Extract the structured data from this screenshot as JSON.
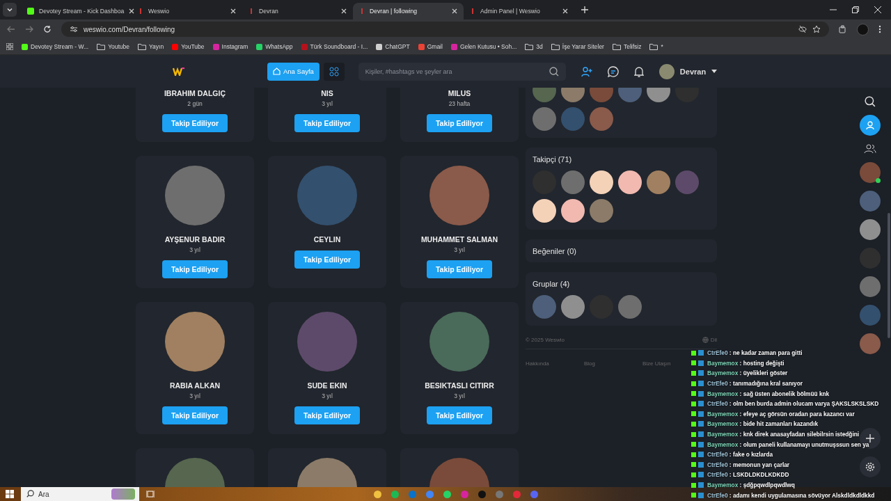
{
  "browser": {
    "tabs": [
      {
        "title": "Devotey Stream - Kick Dashboa",
        "selected": false,
        "kind": "kick"
      },
      {
        "title": "Weswio",
        "selected": false,
        "kind": "site"
      },
      {
        "title": "Devran",
        "selected": false,
        "kind": "site"
      },
      {
        "title": "Devran | following",
        "selected": true,
        "kind": "site"
      },
      {
        "title": "Admin Panel | Weswio",
        "selected": false,
        "kind": "site"
      }
    ],
    "url": "weswio.com/Devran/following",
    "bookmarks": [
      {
        "label": "Devotey Stream - W...",
        "kind": "kick"
      },
      {
        "label": "Youtube",
        "kind": "folder"
      },
      {
        "label": "Yayın",
        "kind": "folder"
      },
      {
        "label": "YouTube",
        "kind": "youtube"
      },
      {
        "label": "Instagram",
        "kind": "instagram"
      },
      {
        "label": "WhatsApp",
        "kind": "whatsapp"
      },
      {
        "label": "Türk Soundboard - I...",
        "kind": "site"
      },
      {
        "label": "ChatGPT",
        "kind": "chatgpt"
      },
      {
        "label": "Gmail",
        "kind": "gmail"
      },
      {
        "label": "Gelen Kutusu • Soh...",
        "kind": "instagram"
      },
      {
        "label": "3d",
        "kind": "folder"
      },
      {
        "label": "İşe Yarar Siteler",
        "kind": "folder"
      },
      {
        "label": "Telifsiz",
        "kind": "folder"
      },
      {
        "label": "*",
        "kind": "folder"
      }
    ]
  },
  "header": {
    "home_button": "Ana Sayfa",
    "search_placeholder": "Kişiler, #hashtags ve şeyler ara",
    "user": "Devran"
  },
  "following": [
    {
      "kind": "full",
      "name": "IBRAHIM DALGIÇ",
      "time": "2 gün",
      "button": "Takip Ediliyor"
    },
    {
      "kind": "full",
      "name": "NIS",
      "time": "3 yıl",
      "button": "Takip Ediliyor"
    },
    {
      "kind": "full",
      "name": "MILUS",
      "time": "23 hafta",
      "button": "Takip Ediliyor"
    },
    {
      "kind": "full",
      "name": "AYŞENUR BADIR",
      "time": "3 yıl",
      "button": "Takip Ediliyor"
    },
    {
      "kind": "full",
      "name": "CEYLIN",
      "button": "Takip Ediliyor"
    },
    {
      "kind": "full",
      "name": "MUHAMMET SALMAN",
      "time": "3 yıl",
      "button": "Takip Ediliyor"
    },
    {
      "kind": "full",
      "name": "RABIA ALKAN",
      "time": "3 yıl",
      "button": "Takip Ediliyor"
    },
    {
      "kind": "full",
      "name": "SUDE EKIN",
      "time": "3 yıl",
      "button": "Takip Ediliyor"
    },
    {
      "kind": "full",
      "name": "BESIKTASLI CITIRR",
      "time": "3 yıl",
      "button": "Takip Ediliyor"
    },
    {
      "kind": "photo"
    },
    {
      "kind": "photo"
    },
    {
      "kind": "photo"
    }
  ],
  "panels": [
    {
      "kind": "avatars",
      "avatars": [
        {
          "kind": "photo"
        },
        {
          "kind": "photo"
        },
        {
          "kind": "photo"
        },
        {
          "kind": "photo"
        },
        {
          "kind": "photo"
        },
        {
          "kind": "photo"
        },
        {
          "kind": "photo"
        },
        {
          "kind": "photo"
        },
        {
          "kind": "photo"
        }
      ]
    },
    {
      "kind": "avatars",
      "title": "Takipçi (71)",
      "avatars": [
        {
          "kind": "photo"
        },
        {
          "kind": "photo"
        },
        {
          "kind": "illustration"
        },
        {
          "kind": "illustration"
        },
        {
          "kind": "photo"
        },
        {
          "kind": "photo"
        },
        {
          "kind": "illustration"
        },
        {
          "kind": "illustration"
        },
        {
          "kind": "photo"
        }
      ]
    },
    {
      "kind": "title",
      "title": "Beğeniler (0)"
    },
    {
      "kind": "avatars",
      "title": "Gruplar (4)",
      "avatars": [
        {
          "kind": "photo"
        },
        {
          "kind": "photo"
        },
        {
          "kind": "photo"
        },
        {
          "kind": "photo"
        }
      ]
    }
  ],
  "footer": {
    "copyright": "© 2025 Weswio",
    "language": "Dil",
    "links": [
      "Hakkında",
      "Blog",
      "Bize Ulaşın"
    ]
  },
  "chat": [
    {
      "user": "CtrEfe0",
      "color": "#9fc3d6",
      "text": ": ne kadar zaman para gitti"
    },
    {
      "user": "Baymemox",
      "color": "#7fd6b8",
      "text": ": hosting değişti"
    },
    {
      "user": "Baymemox",
      "color": "#7fd6b8",
      "text": ": üyelikleri göster"
    },
    {
      "user": "CtrEfe0",
      "color": "#9fc3d6",
      "text": ": tanımadığına kral sanıyor"
    },
    {
      "user": "Baymemox",
      "color": "#7fd6b8",
      "text": ": sağ üsten abonelik bölmüü knk"
    },
    {
      "user": "CtrEfe0",
      "color": "#9fc3d6",
      "text": ": olm ben burda admin olucam varya ŞAKSLSKSLSKD"
    },
    {
      "user": "Baymemox",
      "color": "#7fd6b8",
      "text": ": efeye aç görsün oradan para kazancı var"
    },
    {
      "user": "Baymemox",
      "color": "#7fd6b8",
      "text": ": bide hit zamanları kazandık"
    },
    {
      "user": "Baymemox",
      "color": "#7fd6b8",
      "text": ": knk direk anasayfadan silebilrsin istedğini"
    },
    {
      "user": "Baymemox",
      "color": "#7fd6b8",
      "text": ": olum paneli kullanamayı unutmuşssun sen ya"
    },
    {
      "user": "CtrEfe0",
      "color": "#9fc3d6",
      "text": ": fake o kızlarda"
    },
    {
      "user": "CtrEfe0",
      "color": "#9fc3d6",
      "text": ": memonun yan çarlar"
    },
    {
      "user": "CtrEfe0",
      "color": "#9fc3d6",
      "text": ": LSKDLDKDLKDKDD"
    },
    {
      "user": "Baymemox",
      "color": "#7fd6b8",
      "text": ": şdğpqwdlpqwdlwq"
    },
    {
      "user": "CtrEfe0",
      "color": "#9fc3d6",
      "text": ": adamı kendi uygulamasına sövüyor Alskdldkdldkkd"
    }
  ],
  "rail": {
    "avatars": [
      {
        "kind": "photo",
        "online": true
      },
      {
        "kind": "photo"
      },
      {
        "kind": "photo"
      },
      {
        "kind": "photo"
      },
      {
        "kind": "photo"
      },
      {
        "kind": "photo"
      },
      {
        "kind": "photo"
      }
    ]
  },
  "taskbar": {
    "search_placeholder": "Ara",
    "apps": [
      {
        "kind": "folder"
      },
      {
        "kind": "spotify"
      },
      {
        "kind": "mail"
      },
      {
        "kind": "browser"
      },
      {
        "kind": "whatsapp"
      },
      {
        "kind": "instagram"
      },
      {
        "kind": "tiktok"
      },
      {
        "kind": "camera"
      },
      {
        "kind": "record"
      },
      {
        "kind": "discord"
      }
    ]
  }
}
